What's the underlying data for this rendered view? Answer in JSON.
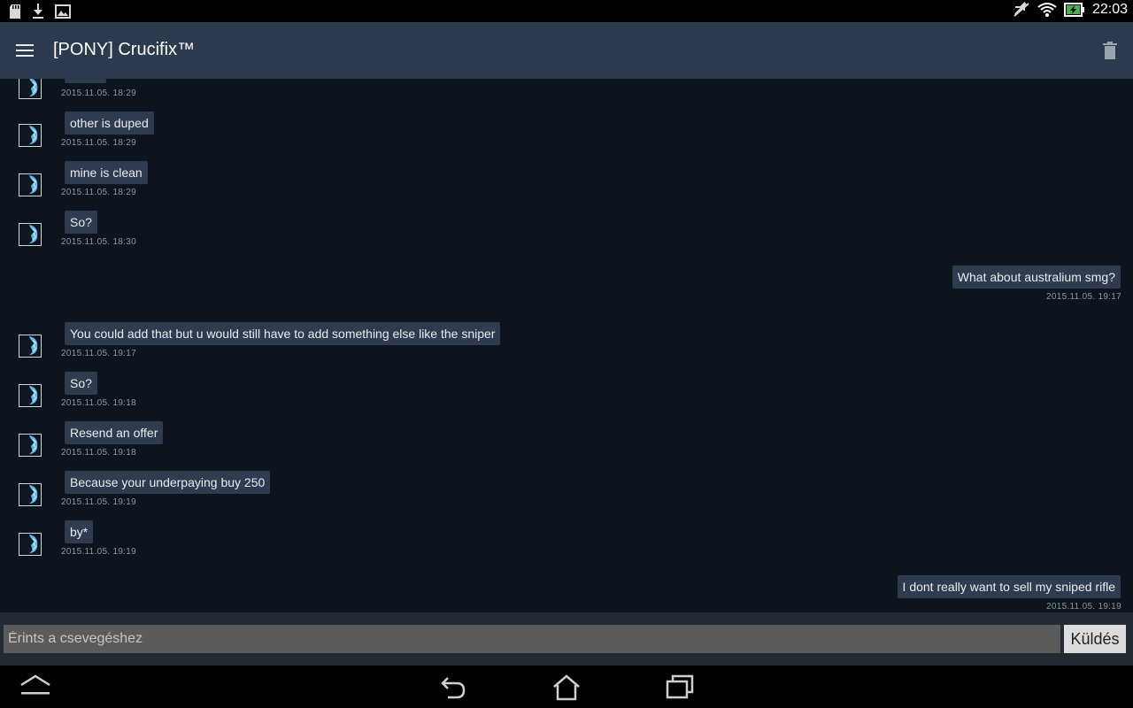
{
  "status_bar": {
    "time": "22:03",
    "left_icons": [
      "sd-card-icon",
      "download-icon",
      "image-icon"
    ],
    "right_icons": [
      "mute-icon",
      "wifi-icon",
      "battery-charging-icon"
    ]
  },
  "app_bar": {
    "title": "[PONY] Crucifix™",
    "menu_icon": "menu-icon",
    "delete_icon": "trash-icon"
  },
  "messages": [
    {
      "side": "in",
      "text": "",
      "time": "2015.11.05. 18:29"
    },
    {
      "side": "in",
      "text": "other is duped",
      "time": "2015.11.05. 18:29"
    },
    {
      "side": "in",
      "text": "mine is clean",
      "time": "2015.11.05. 18:29"
    },
    {
      "side": "in",
      "text": "So?",
      "time": "2015.11.05. 18:30"
    },
    {
      "side": "out",
      "text": "What about australium smg?",
      "time": "2015.11.05. 19:17"
    },
    {
      "side": "in",
      "text": "You could add that but u would still have to add something else like the sniper",
      "time": "2015.11.05. 19:17"
    },
    {
      "side": "in",
      "text": "So?",
      "time": "2015.11.05. 19:18"
    },
    {
      "side": "in",
      "text": "Resend an offer",
      "time": "2015.11.05. 19:18"
    },
    {
      "side": "in",
      "text": "Because your underpaying buy 250",
      "time": "2015.11.05. 19:19"
    },
    {
      "side": "in",
      "text": "by*",
      "time": "2015.11.05. 19:19"
    },
    {
      "side": "out",
      "text": "I dont really want to sell my sniped rifle",
      "time": "2015.11.05. 19:19"
    }
  ],
  "composer": {
    "placeholder": "Érints a csevegéshez",
    "value": "",
    "send_label": "Küldés"
  },
  "nav_bar": {
    "buttons": [
      "expand-icon",
      "back-icon",
      "home-icon",
      "recent-apps-icon"
    ]
  },
  "colors": {
    "background": "#0c141d",
    "app_bar": "#2c3a4d",
    "bubble": "#2f3b4f",
    "timestamp": "#8b95a3"
  }
}
